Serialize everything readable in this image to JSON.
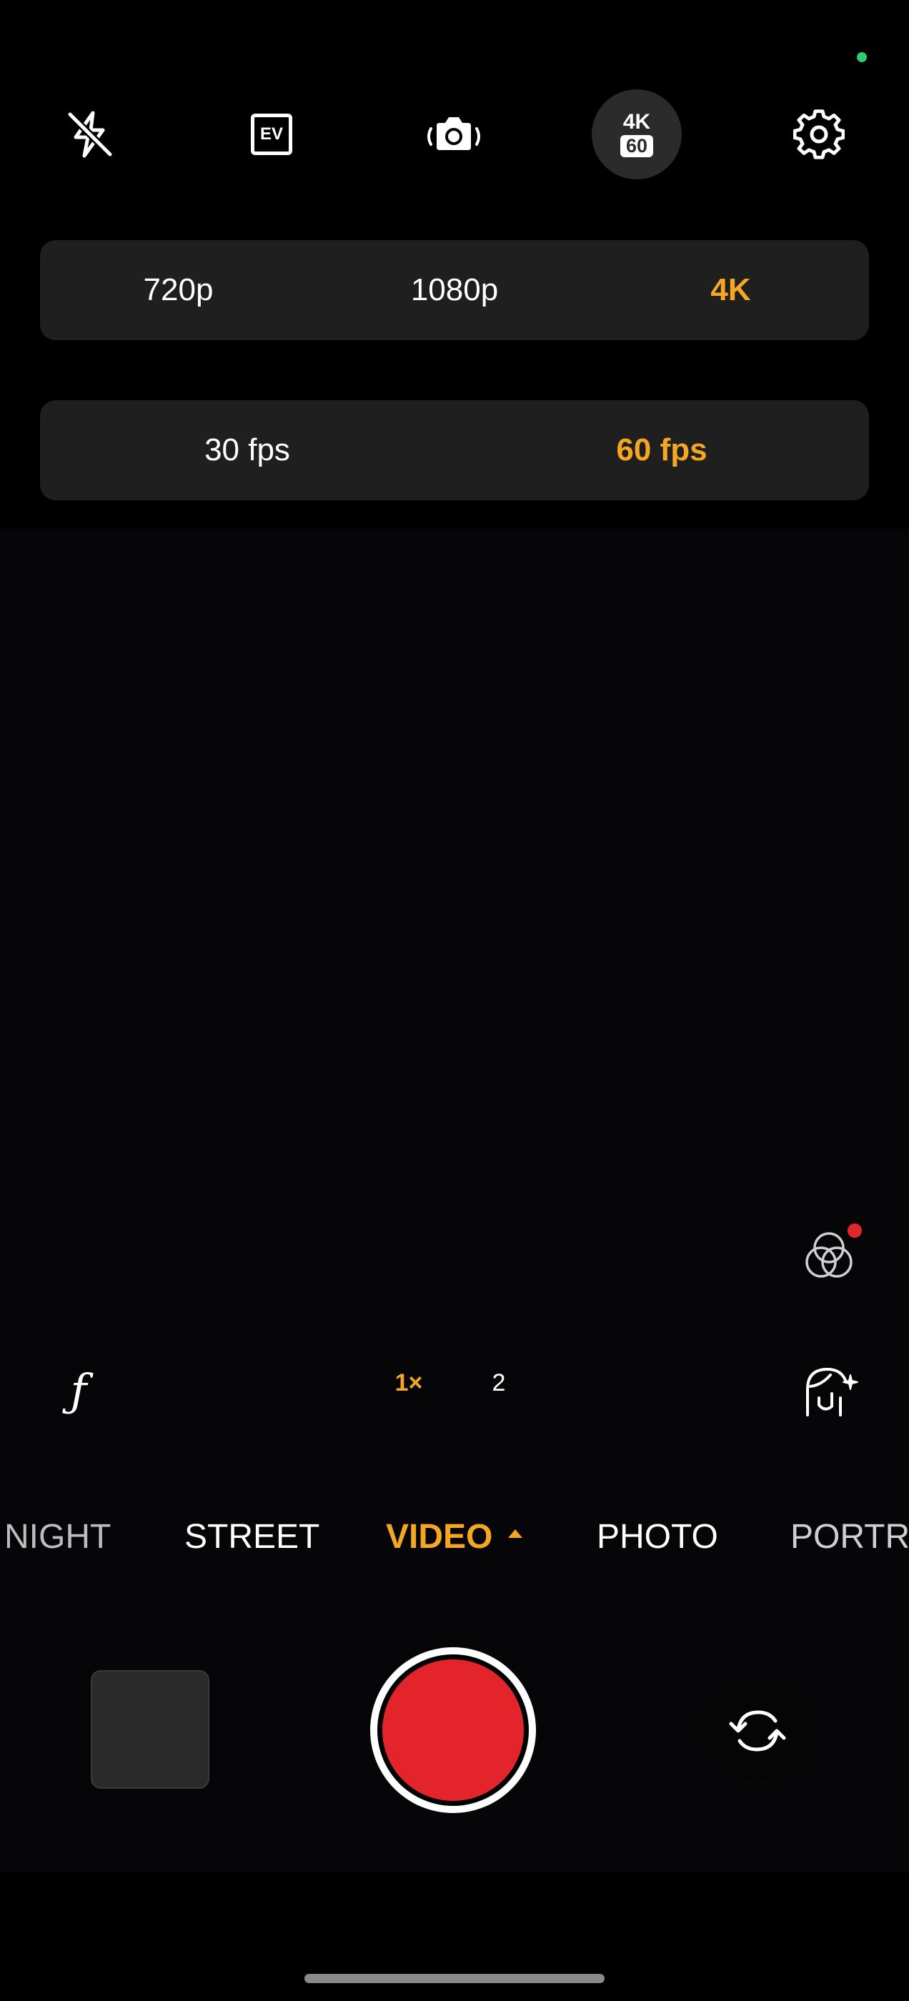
{
  "colors": {
    "accent": "#f5a623",
    "record": "#e3242b",
    "status_dot": "#2ecc71",
    "notification_dot": "#e0282b"
  },
  "toolbar": {
    "icons": [
      "flash-off-icon",
      "exposure-ev-icon",
      "camera-stabilization-icon",
      "resolution-fps-badge",
      "settings-gear-icon"
    ],
    "ev_label": "EV",
    "badge_top": "4K",
    "badge_bottom": "60"
  },
  "resolution": {
    "options": [
      "720p",
      "1080p",
      "4K"
    ],
    "selected": "4K"
  },
  "framerate": {
    "options": [
      "30 fps",
      "60 fps"
    ],
    "selected": "60 fps"
  },
  "controls": {
    "aperture_glyph": "ƒ",
    "zoom": [
      "1×",
      "2"
    ],
    "zoom_selected": "1×"
  },
  "modes": {
    "items": [
      "NIGHT",
      "STREET",
      "VIDEO",
      "PHOTO",
      "PORTRAIT"
    ],
    "selected": "VIDEO"
  }
}
